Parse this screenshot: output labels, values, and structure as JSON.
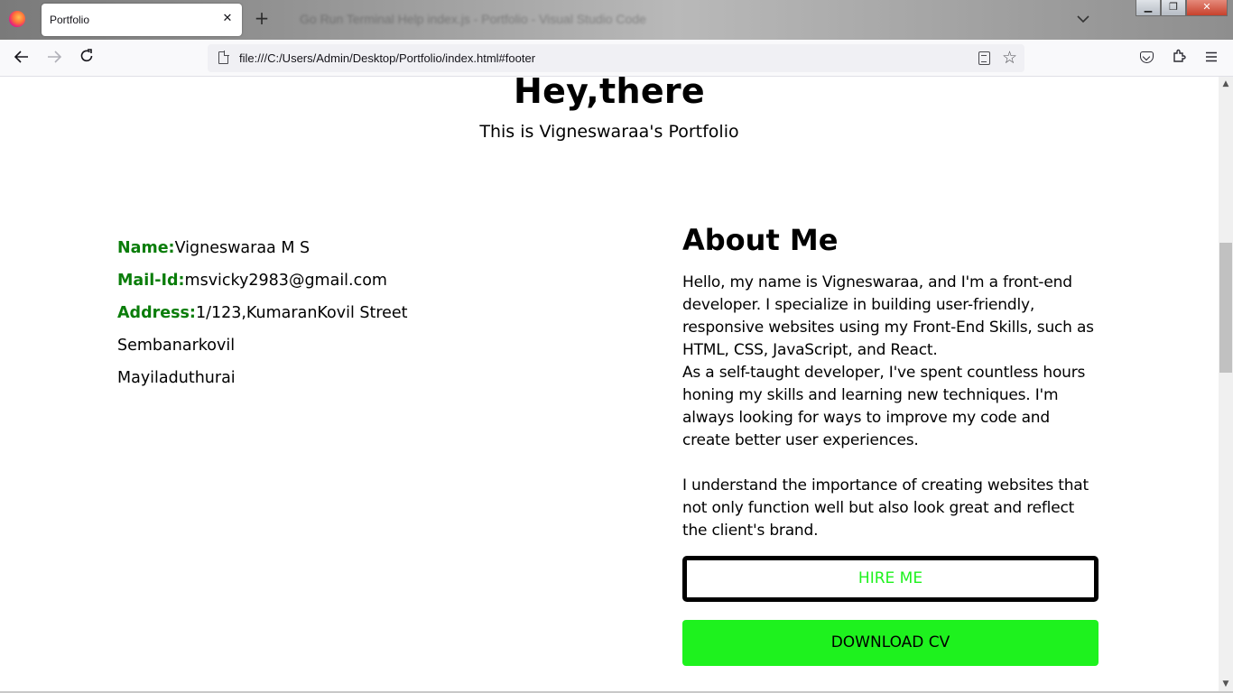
{
  "browser": {
    "tab_title": "Portfolio",
    "tab_close": "✕",
    "new_tab": "+",
    "background_window_title": "Go   Run   Terminal   Help               index.js - Portfolio - Visual Studio Code",
    "url": "file:///C:/Users/Admin/Desktop/Portfolio/index.html#footer",
    "window_controls": {
      "minimize": "▁",
      "maximize": "❐",
      "close": "✕"
    },
    "icons": [
      "firefox-logo",
      "back-arrow-icon",
      "forward-arrow-icon",
      "reload-icon",
      "page-icon",
      "reader-view-icon",
      "bookmark-star-icon",
      "pocket-icon",
      "extensions-icon",
      "menu-icon"
    ]
  },
  "page": {
    "heading": "Hey,there",
    "subheading": "This is Vigneswaraa's Portfolio",
    "contact": {
      "name_label": "Name:",
      "name_value": "Vigneswaraa M S",
      "mail_label": "Mail-Id:",
      "mail_value": "msvicky2983@gmail.com",
      "address_label": "Address:",
      "address_line1": "1/123,KumaranKovil Street",
      "address_line2": "Sembanarkovil",
      "address_line3": "Mayiladuthurai"
    },
    "about": {
      "title": "About Me",
      "paragraph1": "Hello, my name is Vigneswaraa, and I'm a front-end developer. I specialize in building user-friendly, responsive websites using my Front-End Skills, such as HTML, CSS, JavaScript, and React.",
      "paragraph2": "As a self-taught developer, I've spent countless hours honing my skills and learning new techniques. I'm always looking for ways to improve my code and create better user experiences.",
      "paragraph3": "I understand the importance of creating websites that not only function well but also look great and reflect the client's brand."
    },
    "buttons": {
      "hire": "HIRE ME",
      "download": "DOWNLOAD CV"
    }
  },
  "colors": {
    "label_green": "#0a7d0a",
    "accent_green": "#1ef21e",
    "text": "#000000"
  }
}
